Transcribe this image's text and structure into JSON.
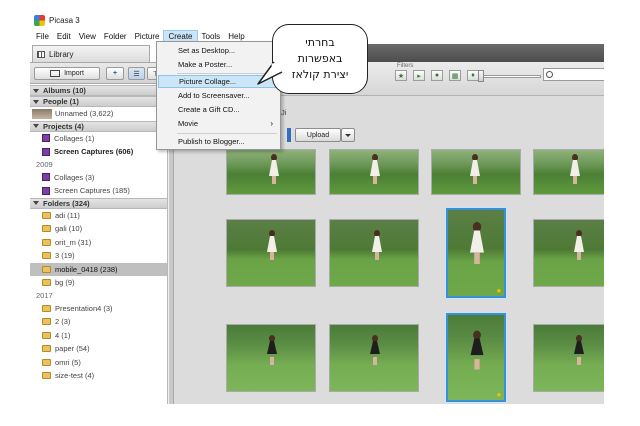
{
  "window": {
    "title": "Picasa 3"
  },
  "menubar": [
    "File",
    "Edit",
    "View",
    "Folder",
    "Picture",
    "Create",
    "Tools",
    "Help"
  ],
  "left": {
    "tab_label": "Library",
    "import_label": "Import",
    "sections": {
      "albums": "Albums (10)",
      "people": "People (1)",
      "projects": "Projects (4)",
      "folders": "Folders (324)"
    },
    "people_item": "Unnamed (3,622)",
    "projects": [
      {
        "label": "Collages (1)",
        "bold": false
      },
      {
        "label": "Screen Captures (606)",
        "bold": true
      }
    ],
    "year_2009": "2009",
    "projects_2009": [
      "Collages (3)",
      "Screen Captures (185)"
    ],
    "folders": [
      "adi (11)",
      "gali (10)",
      "orit_m (31)",
      "3 (19)",
      "mobile_0418 (238)",
      "bg (9)"
    ],
    "year_2017": "2017",
    "folders_2017": [
      "Presentation4 (3)",
      "2 (3)",
      "4 (1)",
      "paper (54)",
      "omri (5)",
      "size-test (4)"
    ]
  },
  "filters": {
    "label": "Filters"
  },
  "upload_label": "Upload",
  "partial_text": "Ji",
  "create_menu": [
    {
      "label": "Set as Desktop...",
      "highlighted": false
    },
    {
      "label": "Make a Poster...",
      "highlighted": false
    },
    {
      "label": "Picture Collage...",
      "highlighted": true
    },
    {
      "label": "Add to Screensaver...",
      "highlighted": false
    },
    {
      "label": "Create a Gift CD...",
      "highlighted": false
    },
    {
      "label": "Movie",
      "highlighted": false,
      "submenu": true
    },
    {
      "label": "Publish to Blogger...",
      "highlighted": false
    }
  ],
  "callout": [
    "בחרתי",
    "באפשרות",
    "יצירת קולאז"
  ]
}
